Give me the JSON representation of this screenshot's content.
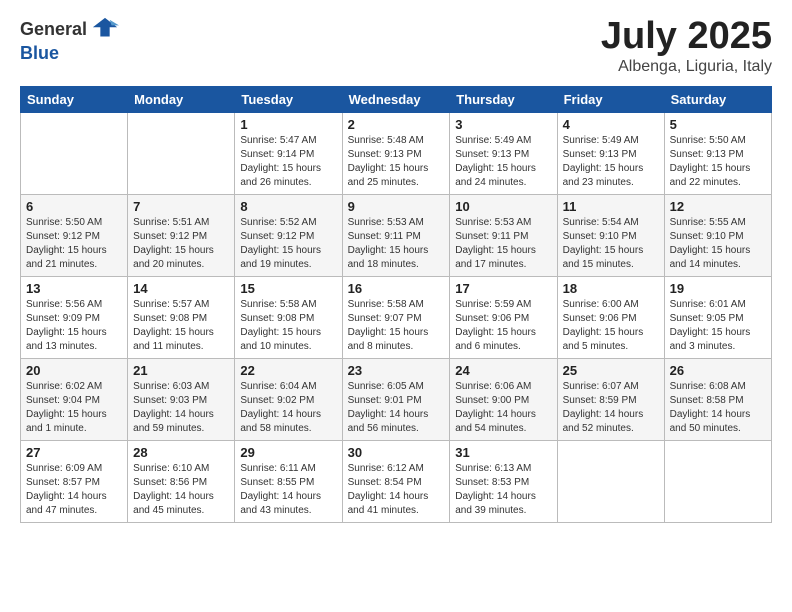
{
  "header": {
    "logo_general": "General",
    "logo_blue": "Blue",
    "month": "July 2025",
    "location": "Albenga, Liguria, Italy"
  },
  "days_of_week": [
    "Sunday",
    "Monday",
    "Tuesday",
    "Wednesday",
    "Thursday",
    "Friday",
    "Saturday"
  ],
  "weeks": [
    [
      {
        "day": "",
        "detail": ""
      },
      {
        "day": "",
        "detail": ""
      },
      {
        "day": "1",
        "detail": "Sunrise: 5:47 AM\nSunset: 9:14 PM\nDaylight: 15 hours\nand 26 minutes."
      },
      {
        "day": "2",
        "detail": "Sunrise: 5:48 AM\nSunset: 9:13 PM\nDaylight: 15 hours\nand 25 minutes."
      },
      {
        "day": "3",
        "detail": "Sunrise: 5:49 AM\nSunset: 9:13 PM\nDaylight: 15 hours\nand 24 minutes."
      },
      {
        "day": "4",
        "detail": "Sunrise: 5:49 AM\nSunset: 9:13 PM\nDaylight: 15 hours\nand 23 minutes."
      },
      {
        "day": "5",
        "detail": "Sunrise: 5:50 AM\nSunset: 9:13 PM\nDaylight: 15 hours\nand 22 minutes."
      }
    ],
    [
      {
        "day": "6",
        "detail": "Sunrise: 5:50 AM\nSunset: 9:12 PM\nDaylight: 15 hours\nand 21 minutes."
      },
      {
        "day": "7",
        "detail": "Sunrise: 5:51 AM\nSunset: 9:12 PM\nDaylight: 15 hours\nand 20 minutes."
      },
      {
        "day": "8",
        "detail": "Sunrise: 5:52 AM\nSunset: 9:12 PM\nDaylight: 15 hours\nand 19 minutes."
      },
      {
        "day": "9",
        "detail": "Sunrise: 5:53 AM\nSunset: 9:11 PM\nDaylight: 15 hours\nand 18 minutes."
      },
      {
        "day": "10",
        "detail": "Sunrise: 5:53 AM\nSunset: 9:11 PM\nDaylight: 15 hours\nand 17 minutes."
      },
      {
        "day": "11",
        "detail": "Sunrise: 5:54 AM\nSunset: 9:10 PM\nDaylight: 15 hours\nand 15 minutes."
      },
      {
        "day": "12",
        "detail": "Sunrise: 5:55 AM\nSunset: 9:10 PM\nDaylight: 15 hours\nand 14 minutes."
      }
    ],
    [
      {
        "day": "13",
        "detail": "Sunrise: 5:56 AM\nSunset: 9:09 PM\nDaylight: 15 hours\nand 13 minutes."
      },
      {
        "day": "14",
        "detail": "Sunrise: 5:57 AM\nSunset: 9:08 PM\nDaylight: 15 hours\nand 11 minutes."
      },
      {
        "day": "15",
        "detail": "Sunrise: 5:58 AM\nSunset: 9:08 PM\nDaylight: 15 hours\nand 10 minutes."
      },
      {
        "day": "16",
        "detail": "Sunrise: 5:58 AM\nSunset: 9:07 PM\nDaylight: 15 hours\nand 8 minutes."
      },
      {
        "day": "17",
        "detail": "Sunrise: 5:59 AM\nSunset: 9:06 PM\nDaylight: 15 hours\nand 6 minutes."
      },
      {
        "day": "18",
        "detail": "Sunrise: 6:00 AM\nSunset: 9:06 PM\nDaylight: 15 hours\nand 5 minutes."
      },
      {
        "day": "19",
        "detail": "Sunrise: 6:01 AM\nSunset: 9:05 PM\nDaylight: 15 hours\nand 3 minutes."
      }
    ],
    [
      {
        "day": "20",
        "detail": "Sunrise: 6:02 AM\nSunset: 9:04 PM\nDaylight: 15 hours\nand 1 minute."
      },
      {
        "day": "21",
        "detail": "Sunrise: 6:03 AM\nSunset: 9:03 PM\nDaylight: 14 hours\nand 59 minutes."
      },
      {
        "day": "22",
        "detail": "Sunrise: 6:04 AM\nSunset: 9:02 PM\nDaylight: 14 hours\nand 58 minutes."
      },
      {
        "day": "23",
        "detail": "Sunrise: 6:05 AM\nSunset: 9:01 PM\nDaylight: 14 hours\nand 56 minutes."
      },
      {
        "day": "24",
        "detail": "Sunrise: 6:06 AM\nSunset: 9:00 PM\nDaylight: 14 hours\nand 54 minutes."
      },
      {
        "day": "25",
        "detail": "Sunrise: 6:07 AM\nSunset: 8:59 PM\nDaylight: 14 hours\nand 52 minutes."
      },
      {
        "day": "26",
        "detail": "Sunrise: 6:08 AM\nSunset: 8:58 PM\nDaylight: 14 hours\nand 50 minutes."
      }
    ],
    [
      {
        "day": "27",
        "detail": "Sunrise: 6:09 AM\nSunset: 8:57 PM\nDaylight: 14 hours\nand 47 minutes."
      },
      {
        "day": "28",
        "detail": "Sunrise: 6:10 AM\nSunset: 8:56 PM\nDaylight: 14 hours\nand 45 minutes."
      },
      {
        "day": "29",
        "detail": "Sunrise: 6:11 AM\nSunset: 8:55 PM\nDaylight: 14 hours\nand 43 minutes."
      },
      {
        "day": "30",
        "detail": "Sunrise: 6:12 AM\nSunset: 8:54 PM\nDaylight: 14 hours\nand 41 minutes."
      },
      {
        "day": "31",
        "detail": "Sunrise: 6:13 AM\nSunset: 8:53 PM\nDaylight: 14 hours\nand 39 minutes."
      },
      {
        "day": "",
        "detail": ""
      },
      {
        "day": "",
        "detail": ""
      }
    ]
  ]
}
